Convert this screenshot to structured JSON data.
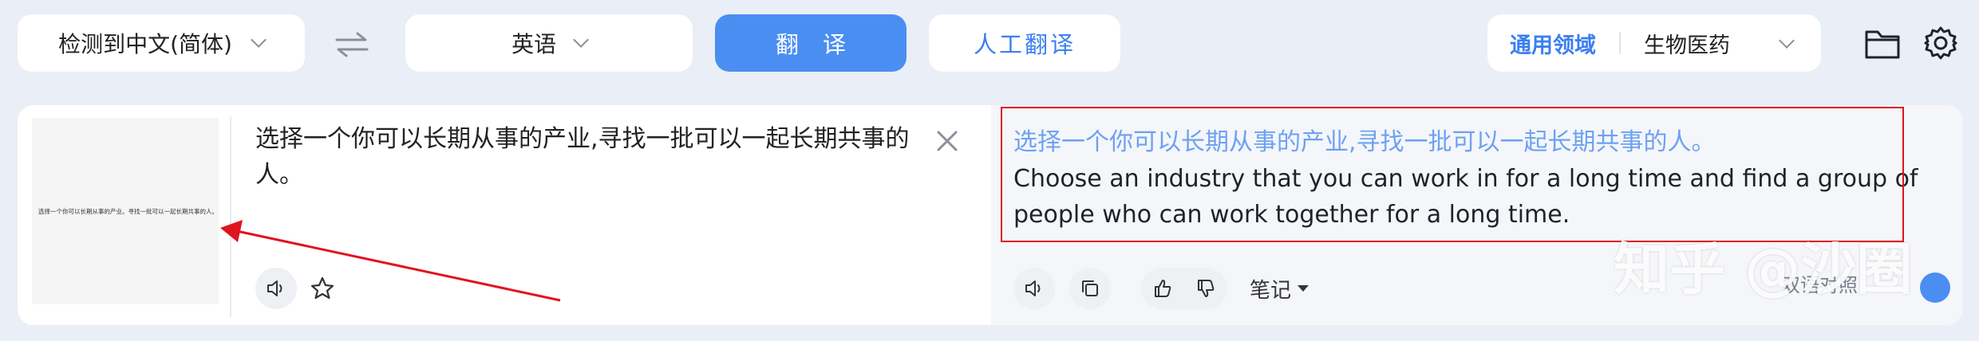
{
  "toolbar": {
    "source_lang": "检测到中文(简体)",
    "target_lang": "英语",
    "translate_label": "翻译",
    "human_translate_label": "人工翻译",
    "domain_general": "通用领域",
    "domain_selected": "生物医药"
  },
  "source": {
    "text": "选择一个你可以长期从事的产业,寻找一批可以一起长期共事的人。",
    "thumbnail_text": "选择一个你可以长期从事的产业。寻找一批可以一起长期共事的人。"
  },
  "result": {
    "source_echo": "选择一个你可以长期从事的产业,寻找一批可以一起长期共事的人。",
    "translation": "Choose an industry that you can work in for a long time and find a group of people who can work together for a long time.",
    "notes_label": "笔记",
    "bilingual_label": "双语对照"
  },
  "watermark": "知乎 @沙圈",
  "colors": {
    "accent": "#4b8ef2",
    "highlight_box": "#e0141e",
    "arrow": "#e0141e"
  }
}
